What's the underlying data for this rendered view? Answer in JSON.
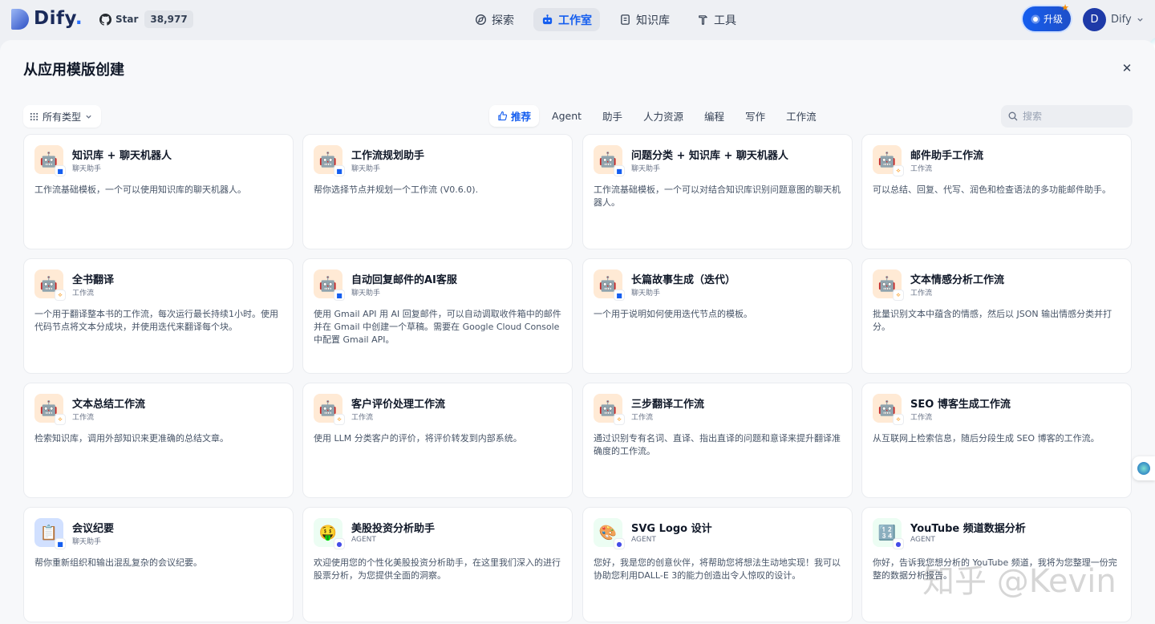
{
  "topbar": {
    "logo_text": "Dify",
    "github_star_label": "Star",
    "github_star_count": "38,977",
    "nav": [
      {
        "label": "探索",
        "icon": "compass-icon"
      },
      {
        "label": "工作室",
        "icon": "robot-icon"
      },
      {
        "label": "知识库",
        "icon": "book-icon"
      },
      {
        "label": "工具",
        "icon": "hammer-icon"
      }
    ],
    "upgrade_label": "升级",
    "user_initial": "D",
    "user_name": "Dify"
  },
  "panel": {
    "title": "从应用模版创建",
    "type_filter": "所有类型",
    "tabs": [
      {
        "label": "推荐"
      },
      {
        "label": "Agent"
      },
      {
        "label": "助手"
      },
      {
        "label": "人力资源"
      },
      {
        "label": "编程"
      },
      {
        "label": "写作"
      },
      {
        "label": "工作流"
      }
    ],
    "search_placeholder": "搜索"
  },
  "cards": [
    {
      "name": "知识库 + 聊天机器人",
      "type": "聊天助手",
      "desc": "工作流基础模板，一个可以使用知识库的聊天机器人。",
      "icon": "🤖",
      "badge": "chat"
    },
    {
      "name": "工作流规划助手",
      "type": "聊天助手",
      "desc": "帮你选择节点并规划一个工作流 (V0.6.0).",
      "icon": "🤖",
      "badge": "chat"
    },
    {
      "name": "问题分类 + 知识库 + 聊天机器人",
      "type": "聊天助手",
      "desc": "工作流基础模板，一个可以对结合知识库识别问题意图的聊天机器人。",
      "icon": "🤖",
      "badge": "chat"
    },
    {
      "name": "邮件助手工作流",
      "type": "工作流",
      "desc": "可以总结、回复、代写、润色和检查语法的多功能邮件助手。",
      "icon": "🤖",
      "badge": "flow"
    },
    {
      "name": "全书翻译",
      "type": "工作流",
      "desc": "一个用于翻译整本书的工作流，每次运行最长持续1小时。使用代码节点将文本分成块，并使用迭代来翻译每个块。",
      "icon": "🤖",
      "badge": "flow"
    },
    {
      "name": "自动回复邮件的AI客服",
      "type": "聊天助手",
      "desc": "使用 Gmail API 用 AI 回复邮件，可以自动调取收件箱中的邮件并在 Gmail 中创建一个草稿。需要在 Google Cloud Console 中配置 Gmail API。",
      "icon": "🤖",
      "badge": "chat"
    },
    {
      "name": "长篇故事生成（迭代）",
      "type": "聊天助手",
      "desc": "一个用于说明如何使用迭代节点的模板。",
      "icon": "🤖",
      "badge": "chat"
    },
    {
      "name": "文本情感分析工作流",
      "type": "工作流",
      "desc": "批量识别文本中蕴含的情感，然后以 JSON 输出情感分类并打分。",
      "icon": "🤖",
      "badge": "flow"
    },
    {
      "name": "文本总结工作流",
      "type": "工作流",
      "desc": "检索知识库，调用外部知识来更准确的总结文章。",
      "icon": "🤖",
      "badge": "flow"
    },
    {
      "name": "客户评价处理工作流",
      "type": "工作流",
      "desc": "使用 LLM 分类客户的评价，将评价转发到内部系统。",
      "icon": "🤖",
      "badge": "flow"
    },
    {
      "name": "三步翻译工作流",
      "type": "工作流",
      "desc": "通过识别专有名词、直译、指出直译的问题和意译来提升翻译准确度的工作流。",
      "icon": "🤖",
      "badge": "flow"
    },
    {
      "name": "SEO 博客生成工作流",
      "type": "工作流",
      "desc": "从互联网上检索信息，随后分段生成 SEO 博客的工作流。",
      "icon": "🤖",
      "badge": "flow"
    },
    {
      "name": "会议纪要",
      "type": "聊天助手",
      "desc": "帮你重新组织和输出混乱复杂的会议纪要。",
      "icon": "📋",
      "badge": "chat"
    },
    {
      "name": "美股投资分析助手",
      "type": "AGENT",
      "desc": "欢迎使用您的个性化美股投资分析助手，在这里我们深入的进行股票分析，为您提供全面的洞察。",
      "icon": "🤑",
      "badge": "agent"
    },
    {
      "name": "SVG Logo 设计",
      "type": "AGENT",
      "desc": "您好，我是您的创意伙伴，将帮助您将想法生动地实现！我可以协助您利用DALL-E 3的能力创造出令人惊叹的设计。",
      "icon": "🎨",
      "badge": "agent"
    },
    {
      "name": "YouTube 频道数据分析",
      "type": "AGENT",
      "desc": "你好，告诉我您想分析的 YouTube 频道，我将为您整理一份完整的数据分析报告。",
      "icon": "🔢",
      "badge": "agent"
    }
  ],
  "watermark": "知乎 @Kevin"
}
